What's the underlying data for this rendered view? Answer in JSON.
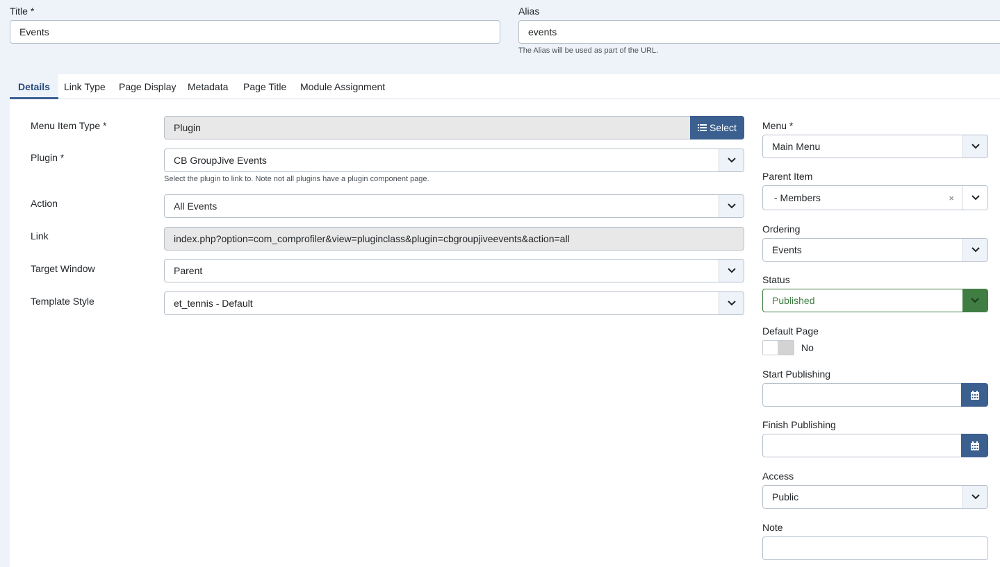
{
  "title": {
    "label": "Title *",
    "value": "Events"
  },
  "alias": {
    "label": "Alias",
    "value": "events",
    "hint": "The Alias will be used as part of the URL."
  },
  "tabs": [
    {
      "label": "Details"
    },
    {
      "label": "Link Type"
    },
    {
      "label": "Page Display"
    },
    {
      "label": "Metadata"
    },
    {
      "label": "Page Title"
    },
    {
      "label": "Module Assignment"
    }
  ],
  "details": {
    "menu_item_type": {
      "label": "Menu Item Type *",
      "value": "Plugin",
      "button": "Select"
    },
    "plugin": {
      "label": "Plugin *",
      "value": "CB GroupJive Events",
      "hint": "Select the plugin to link to. Note not all plugins have a plugin component page."
    },
    "action": {
      "label": "Action",
      "value": "All Events"
    },
    "link": {
      "label": "Link",
      "value": "index.php?option=com_comprofiler&view=pluginclass&plugin=cbgroupjiveevents&action=all"
    },
    "target_window": {
      "label": "Target Window",
      "value": "Parent"
    },
    "template_style": {
      "label": "Template Style",
      "value": "et_tennis - Default"
    }
  },
  "sidebar": {
    "menu": {
      "label": "Menu *",
      "value": "Main Menu"
    },
    "parent_item": {
      "label": "Parent Item",
      "value": "- Members",
      "clear": "×"
    },
    "ordering": {
      "label": "Ordering",
      "value": "Events"
    },
    "status": {
      "label": "Status",
      "value": "Published",
      "color": "#3f7d43"
    },
    "default_page": {
      "label": "Default Page",
      "value": "No"
    },
    "start_publishing": {
      "label": "Start Publishing",
      "value": ""
    },
    "finish_publishing": {
      "label": "Finish Publishing",
      "value": ""
    },
    "access": {
      "label": "Access",
      "value": "Public"
    },
    "note": {
      "label": "Note",
      "value": ""
    }
  },
  "colors": {
    "accent": "#3b5f8f",
    "success": "#3f7d43",
    "background": "#eef2f9"
  },
  "icons": {
    "chevron": "chevron-down-icon",
    "list": "list-icon",
    "calendar": "calendar-icon"
  }
}
